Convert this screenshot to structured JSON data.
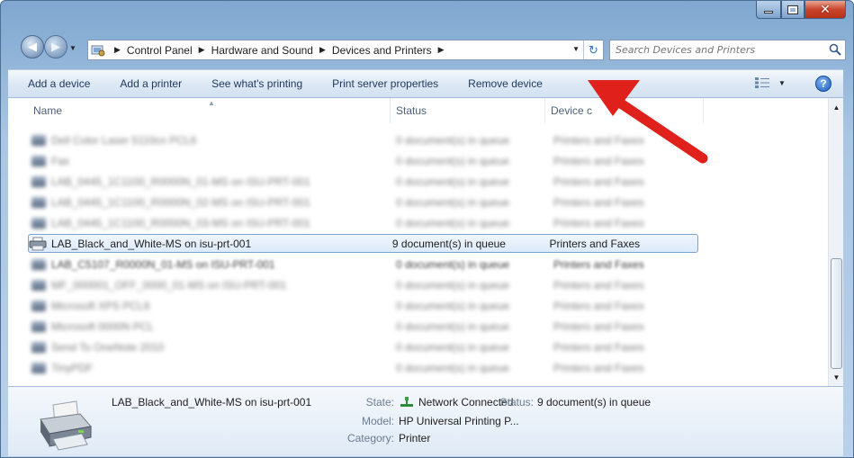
{
  "window": {
    "caption_buttons": {
      "minimize": "minimize",
      "maximize": "maximize",
      "close": "✕"
    }
  },
  "address_bar": {
    "crumbs": [
      "Control Panel",
      "Hardware and Sound",
      "Devices and Printers"
    ],
    "separator": "▶"
  },
  "search": {
    "placeholder": "Search Devices and Printers"
  },
  "command_bar": {
    "items": [
      "Add a device",
      "Add a printer",
      "See what's printing",
      "Print server properties",
      "Remove device"
    ],
    "help": "?"
  },
  "columns": {
    "name": "Name",
    "status": "Status",
    "category": "Device c"
  },
  "devices": [
    {
      "name": "Dell Color Laser 5110cn PCL6",
      "status": "0 document(s) in queue",
      "category": "Printers and Faxes",
      "blurred": true
    },
    {
      "name": "Fax",
      "status": "0 document(s) in queue",
      "category": "Printers and Faxes",
      "blurred": true
    },
    {
      "name": "LAB_0445_1C1100_R0000N_01-MS on ISU-PRT-001",
      "status": "0 document(s) in queue",
      "category": "Printers and Faxes",
      "blurred": true
    },
    {
      "name": "LAB_0445_1C1100_R0000N_02-MS on ISU-PRT-001",
      "status": "0 document(s) in queue",
      "category": "Printers and Faxes",
      "blurred": true
    },
    {
      "name": "LAB_0445_1C1100_R0000N_03-MS on ISU-PRT-001",
      "status": "0 document(s) in queue",
      "category": "Printers and Faxes",
      "blurred": true
    },
    {
      "name": "LAB_Black_and_White-MS on isu-prt-001",
      "status": "9 document(s) in queue",
      "category": "Printers and Faxes",
      "blurred": false,
      "selected": true
    },
    {
      "name": "LAB_C5107_R0000N_01-MS on ISU-PRT-001",
      "status": "0 document(s) in queue",
      "category": "Printers and Faxes",
      "blurred": true
    },
    {
      "name": "MF_000001_OFF_0000_01-MS on ISU-PRT-001",
      "status": "0 document(s) in queue",
      "category": "Printers and Faxes",
      "blurred": true
    },
    {
      "name": "Microsoft XPS PCL6",
      "status": "0 document(s) in queue",
      "category": "Printers and Faxes",
      "blurred": true
    },
    {
      "name": "Microsoft 0000N PCL",
      "status": "0 document(s) in queue",
      "category": "Printers and Faxes",
      "blurred": true
    },
    {
      "name": "Send To OneNote 2010",
      "status": "0 document(s) in queue",
      "category": "Printers and Faxes",
      "blurred": true
    },
    {
      "name": "TinyPDF",
      "status": "0 document(s) in queue",
      "category": "Printers and Faxes",
      "blurred": true
    }
  ],
  "details": {
    "title": "LAB_Black_and_White-MS on isu-prt-001",
    "state_label": "State:",
    "state_value": "Network Connected",
    "status_label": "Status:",
    "status_value": "9 document(s) in queue",
    "model_label": "Model:",
    "model_value": "HP Universal Printing P...",
    "category_label": "Category:",
    "category_value": "Printer"
  },
  "colors": {
    "annotation_arrow": "#e0201a",
    "selection_border": "#7da2ce"
  }
}
